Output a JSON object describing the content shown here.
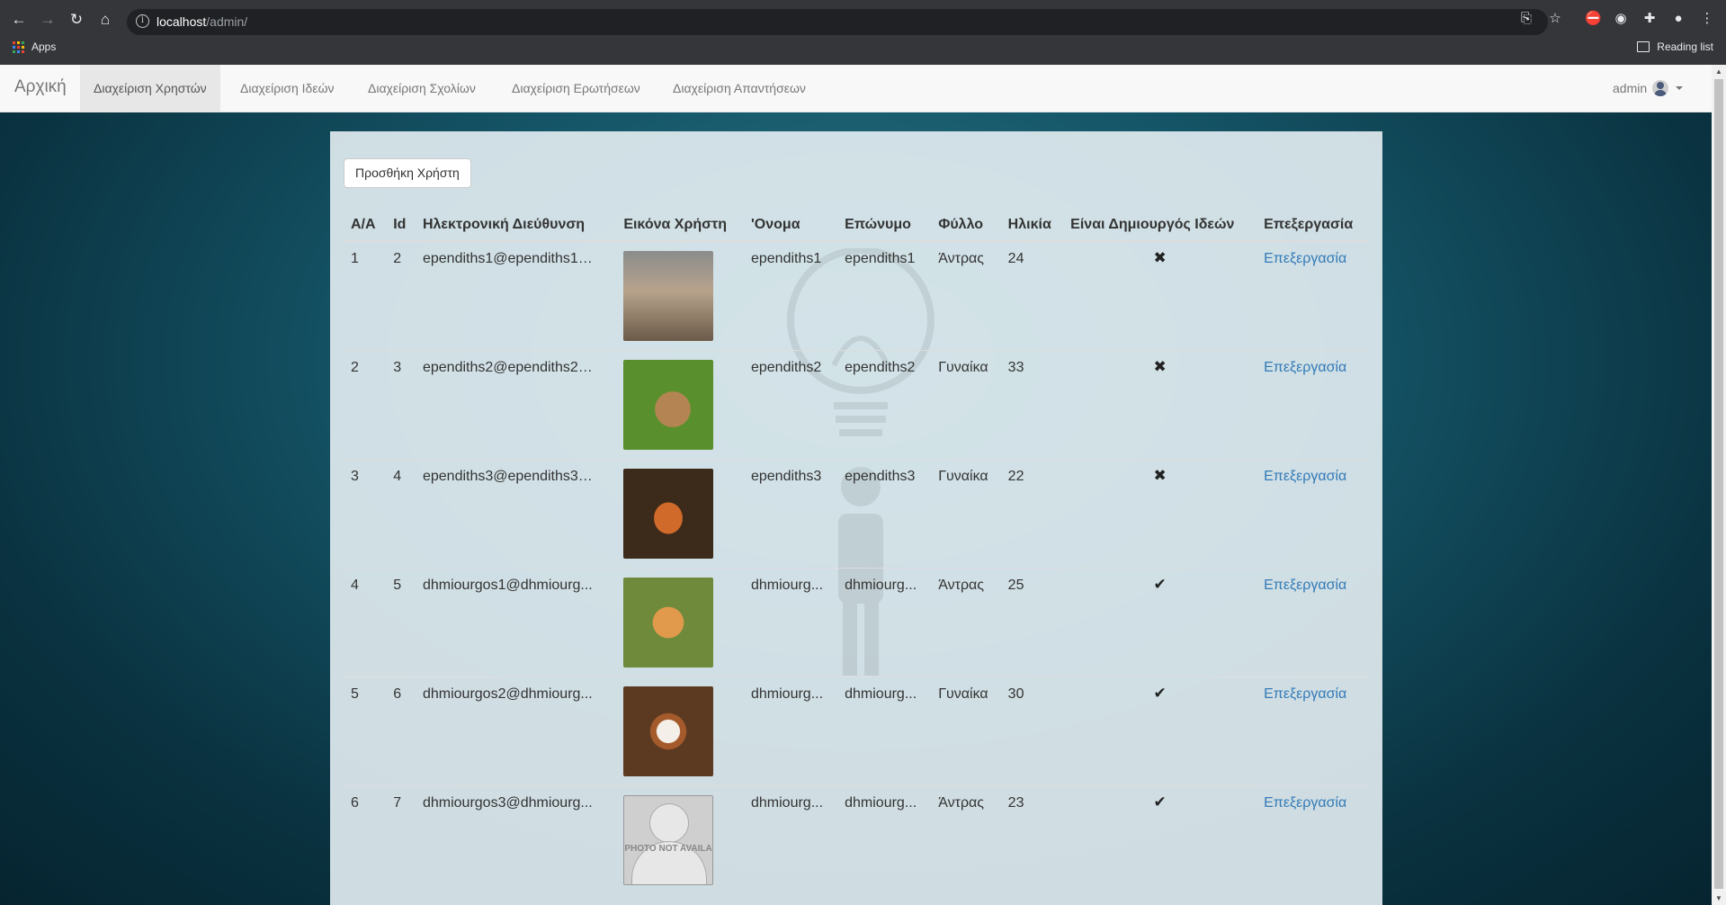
{
  "browser": {
    "url_host": "localhost",
    "url_path": "/admin/",
    "bookmarks_apps": "Apps",
    "reading_list": "Reading list"
  },
  "navbar": {
    "brand": "Αρχική",
    "items": [
      {
        "label": "Διαχείριση Χρηστών",
        "active": true
      },
      {
        "label": "Διαχείριση Ιδεών",
        "active": false
      },
      {
        "label": "Διαχείριση Σχολίων",
        "active": false
      },
      {
        "label": "Διαχείριση Ερωτήσεων",
        "active": false
      },
      {
        "label": "Διαχείριση Απαντήσεων",
        "active": false
      }
    ],
    "user": "admin"
  },
  "main": {
    "add_button": "Προσθήκη Χρήστη",
    "columns": [
      "A/A",
      "Id",
      "Ηλεκτρονική Διεύθυνση",
      "Εικόνα Χρήστη",
      "'Ονομα",
      "Επώνυμο",
      "Φύλλο",
      "Ηλικία",
      "Είναι Δημιουργός Ιδεών",
      "Επεξεργασία"
    ],
    "rows": [
      {
        "aa": "1",
        "id": "2",
        "email": "ependiths1@ependiths1....",
        "image": "tiger-cub",
        "first": "ependiths1",
        "last": "ependiths1",
        "gender": "Άντρας",
        "age": "24",
        "creator": "✖",
        "edit": "Επεξεργασία"
      },
      {
        "aa": "2",
        "id": "3",
        "email": "ependiths2@ependiths2....",
        "image": "rabbit",
        "first": "ependiths2",
        "last": "ependiths2",
        "gender": "Γυναίκα",
        "age": "33",
        "creator": "✖",
        "edit": "Επεξεργασία"
      },
      {
        "aa": "3",
        "id": "4",
        "email": "ependiths3@ependiths3....",
        "image": "fox",
        "first": "ependiths3",
        "last": "ependiths3",
        "gender": "Γυναίκα",
        "age": "22",
        "creator": "✖",
        "edit": "Επεξεργασία"
      },
      {
        "aa": "4",
        "id": "5",
        "email": "dhmiourgos1@dhmiourg...",
        "image": "kitten",
        "first": "dhmiourg...",
        "last": "dhmiourg...",
        "gender": "Άντρας",
        "age": "25",
        "creator": "✔",
        "edit": "Επεξεργασία"
      },
      {
        "aa": "5",
        "id": "6",
        "email": "dhmiourgos2@dhmiourg...",
        "image": "puppy",
        "first": "dhmiourg...",
        "last": "dhmiourg...",
        "gender": "Γυναίκα",
        "age": "30",
        "creator": "✔",
        "edit": "Επεξεργασία"
      },
      {
        "aa": "6",
        "id": "7",
        "email": "dhmiourgos3@dhmiourg...",
        "image": "photo-not-available",
        "first": "dhmiourg...",
        "last": "dhmiourg...",
        "gender": "Άντρας",
        "age": "23",
        "creator": "✔",
        "edit": "Επεξεργασία"
      }
    ],
    "placeholder_image_text": "PHOTO NOT AVAILABLE"
  }
}
